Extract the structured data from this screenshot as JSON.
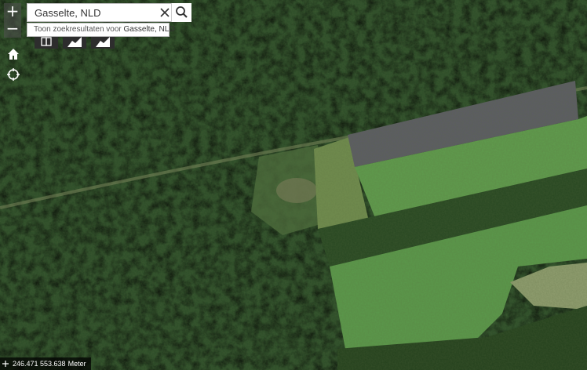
{
  "map": {
    "type": "satellite-imagery",
    "colors": {
      "forest_dark": "#23401f",
      "forest_mid": "#35552c",
      "meadow": "#679448",
      "field_bright": "#5f9a4c",
      "plowed_field": "#5e5e62",
      "track": "#8a9168"
    }
  },
  "controls": {
    "zoom_in": "+",
    "zoom_out": "−",
    "home_icon": "home-icon",
    "locate_icon": "locate-icon"
  },
  "search": {
    "value": "Gasselte, NLD",
    "placeholder": "",
    "clear_icon": "close-icon",
    "search_icon": "search-icon"
  },
  "suggestion": {
    "prefix": "Toon zoekresultaten voor",
    "term": "Gasselte, NLD"
  },
  "tools": [
    {
      "icon": "layers-icon"
    },
    {
      "icon": "elevation-icon"
    },
    {
      "icon": "elevation-icon"
    }
  ],
  "scale": {
    "coordinates": "246.471 553.638",
    "unit": "Meter"
  }
}
